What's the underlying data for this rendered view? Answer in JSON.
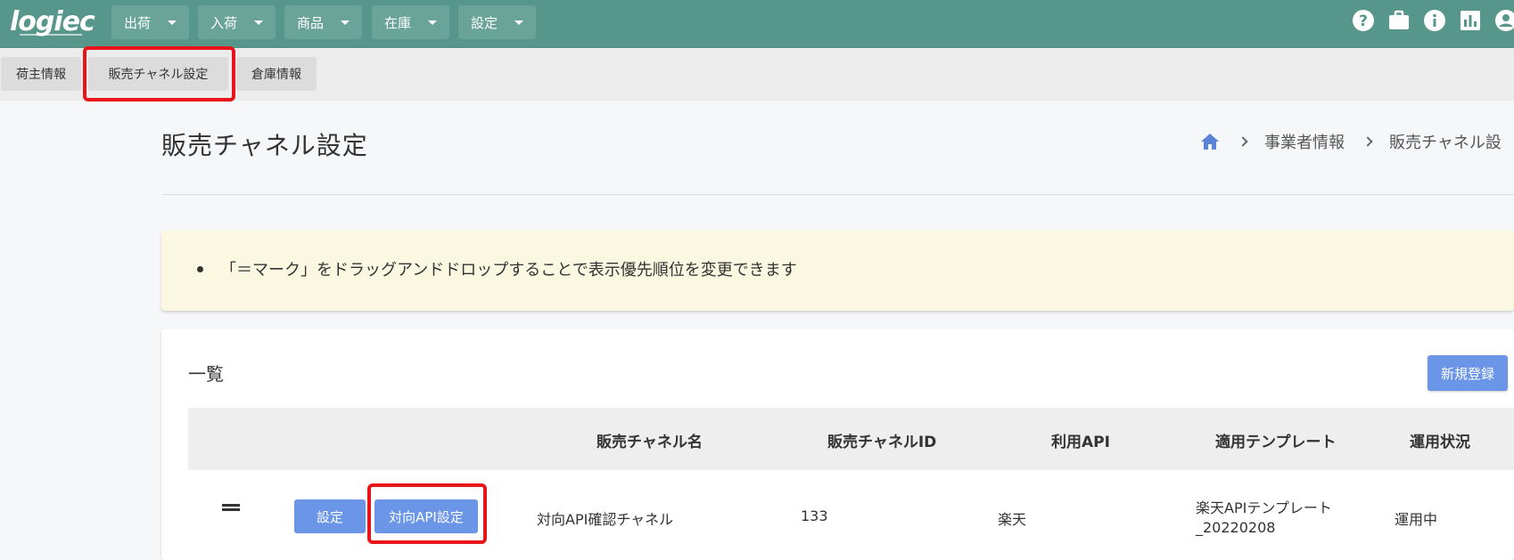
{
  "header": {
    "logo": "logiec",
    "menus": [
      {
        "label": "出荷"
      },
      {
        "label": "入荷"
      },
      {
        "label": "商品"
      },
      {
        "label": "在庫"
      },
      {
        "label": "設定"
      }
    ],
    "icons": [
      "help-icon",
      "briefcase-icon",
      "info-icon",
      "chart-icon",
      "user-icon"
    ]
  },
  "subtabs": [
    {
      "label": "荷主情報"
    },
    {
      "label": "販売チャネル設定"
    },
    {
      "label": "倉庫情報"
    }
  ],
  "page": {
    "title": "販売チャネル設定",
    "breadcrumb": [
      "事業者情報",
      "販売チャネル設"
    ]
  },
  "notice": {
    "text": "「＝マーク」をドラッグアンドドロップすることで表示優先順位を変更できます"
  },
  "list": {
    "title": "一覧",
    "new_button": "新規登録",
    "columns": [
      "販売チャネル名",
      "販売チャネルID",
      "利用API",
      "適用テンプレート",
      "運用状況"
    ],
    "rows": [
      {
        "settings_button": "設定",
        "api_button": "対向API設定",
        "channel_name": "対向API確認チャネル",
        "channel_id": "133",
        "api": "楽天",
        "template_line1": "楽天APIテンプレート",
        "template_line2": "_20220208",
        "status": "運用中"
      }
    ]
  },
  "colors": {
    "header_bg": "#57968a",
    "accent_blue": "#6b96e8",
    "highlight_red": "#e8131b",
    "notice_bg": "#fbf8e1"
  }
}
